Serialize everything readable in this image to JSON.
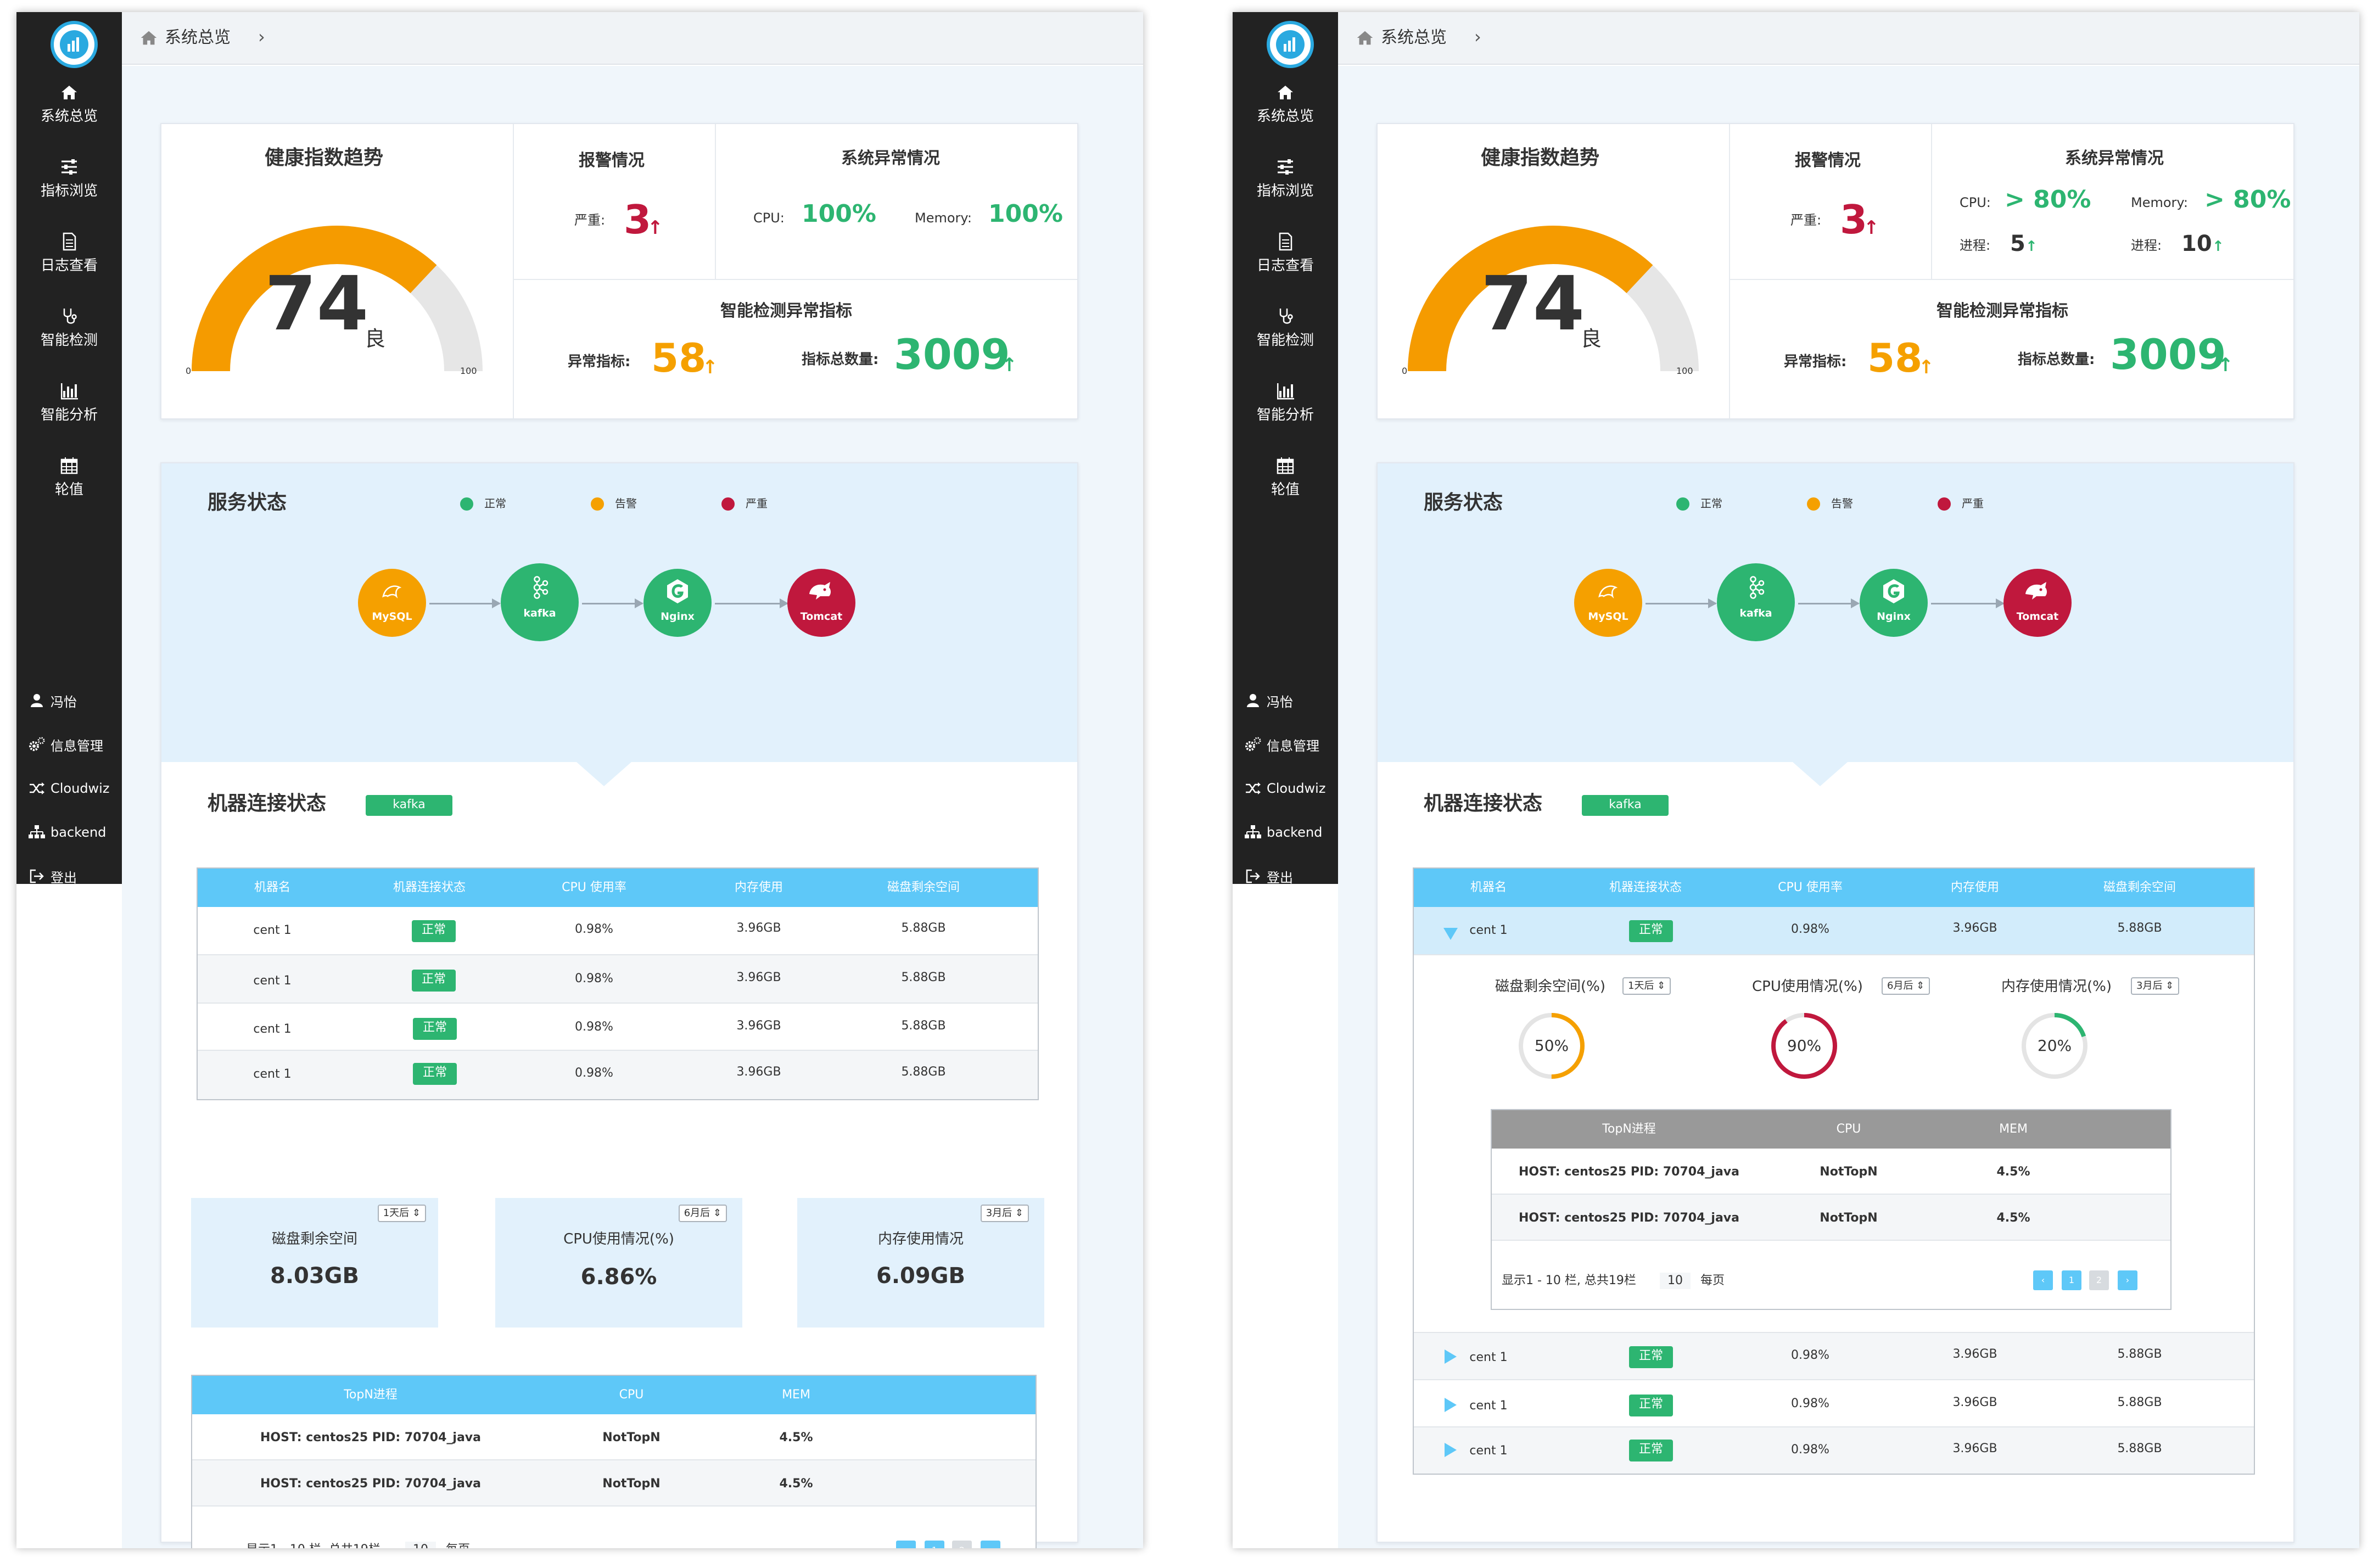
{
  "sidebar": {
    "items": [
      {
        "label": "系统总览",
        "icon": "home-icon"
      },
      {
        "label": "指标浏览",
        "icon": "sliders-icon"
      },
      {
        "label": "日志查看",
        "icon": "document-icon"
      },
      {
        "label": "智能检测",
        "icon": "stethoscope-icon"
      },
      {
        "label": "智能分析",
        "icon": "bar-chart-icon"
      },
      {
        "label": "轮值",
        "icon": "calendar-icon"
      }
    ],
    "user_items": [
      {
        "label": "冯怡",
        "icon": "user-icon"
      },
      {
        "label": "信息管理",
        "icon": "cogs-icon"
      },
      {
        "label": "Cloudwiz",
        "icon": "shuffle-icon"
      },
      {
        "label": "backend",
        "icon": "sitemap-icon"
      },
      {
        "label": "登出",
        "icon": "logout-icon"
      }
    ]
  },
  "breadcrumb": {
    "label": "系统总览"
  },
  "health": {
    "title": "健康指数趋势",
    "score": "74",
    "score_fraction": 0.74,
    "level": "良",
    "min": "0",
    "max": "100"
  },
  "alarm": {
    "title": "报警情况",
    "severe_label": "严重:",
    "severe_value": "3",
    "up_arrow": "↑"
  },
  "anomaly_left": {
    "title": "系统异常情况",
    "cpu_label": "CPU:",
    "cpu_value": "100%",
    "mem_label": "Memory:",
    "mem_value": "100%"
  },
  "anomaly_right": {
    "title": "系统异常情况",
    "cpu_label": "CPU:",
    "cpu_value": "> 80%",
    "mem_label": "Memory:",
    "mem_value": "> 80%",
    "proc_label": "进程:",
    "cpu_proc": "5",
    "mem_proc": "10"
  },
  "smart": {
    "title": "智能检测异常指标",
    "abnormal_label": "异常指标:",
    "abnormal_value": "58",
    "total_label": "指标总数量:",
    "total_value": "3009"
  },
  "services": {
    "title": "服务状态",
    "legend": [
      {
        "label": "正常",
        "color": "#2db571"
      },
      {
        "label": "告警",
        "color": "#f5a000"
      },
      {
        "label": "严重",
        "color": "#c0183d"
      }
    ],
    "nodes": [
      {
        "label": "MySQL",
        "icon": "mysql-dolphin-icon",
        "color": "#f5a000"
      },
      {
        "label": "kafka",
        "icon": "kafka-icon",
        "color": "#2db571"
      },
      {
        "label": "Nginx",
        "icon": "nginx-icon",
        "color": "#2db571"
      },
      {
        "label": "Tomcat",
        "icon": "tomcat-icon",
        "color": "#c0183d"
      }
    ]
  },
  "machines": {
    "title": "机器连接状态",
    "tag": "kafka",
    "columns": [
      "机器名",
      "机器连接状态",
      "CPU 使用率",
      "内存使用",
      "磁盘剩余空间"
    ],
    "rows": [
      {
        "name": "cent 1",
        "status": "正常",
        "cpu": "0.98%",
        "mem": "3.96GB",
        "disk": "5.88GB"
      },
      {
        "name": "cent 1",
        "status": "正常",
        "cpu": "0.98%",
        "mem": "3.96GB",
        "disk": "5.88GB"
      },
      {
        "name": "cent 1",
        "status": "正常",
        "cpu": "0.98%",
        "mem": "3.96GB",
        "disk": "5.88GB"
      },
      {
        "name": "cent 1",
        "status": "正常",
        "cpu": "0.98%",
        "mem": "3.96GB",
        "disk": "5.88GB"
      }
    ]
  },
  "stats": [
    {
      "title": "磁盘剩余空间",
      "value": "8.03GB",
      "select": "1天后 ⇕"
    },
    {
      "title": "CPU使用情况(%)",
      "value": "6.86%",
      "select": "6月后 ⇕"
    },
    {
      "title": "内存使用情况",
      "value": "6.09GB",
      "select": "3月后 ⇕"
    }
  ],
  "expanded": {
    "metrics": [
      {
        "title": "磁盘剩余空间(%)",
        "select": "1天后 ⇕",
        "value": "50%",
        "fraction": 0.5,
        "color": "#f5a000"
      },
      {
        "title": "CPU使用情况(%)",
        "select": "6月后 ⇕",
        "value": "90%",
        "fraction": 0.9,
        "color": "#c0183d"
      },
      {
        "title": "内存使用情况(%)",
        "select": "3月后 ⇕",
        "value": "20%",
        "fraction": 0.2,
        "color": "#2db571"
      }
    ]
  },
  "topn": {
    "columns": [
      "TopN进程",
      "CPU",
      "MEM"
    ],
    "rows": [
      {
        "host": "HOST: centos25  PID: 70704_java",
        "cpu": "NotTopN",
        "mem": "4.5%"
      },
      {
        "host": "HOST: centos25  PID: 70704_java",
        "cpu": "NotTopN",
        "mem": "4.5%"
      }
    ],
    "footer_left": "显示1 - 10 栏,  总共19栏",
    "page_size": "10",
    "footer_right": "每页",
    "pages": [
      "‹",
      "1",
      "2",
      "›"
    ]
  },
  "colors": {
    "sidebar_bg": "#222222",
    "table_header": "#5ec8f8",
    "green": "#2db571",
    "orange": "#f5a000",
    "red": "#c0183d",
    "panel_blue": "#e2f1fc"
  }
}
